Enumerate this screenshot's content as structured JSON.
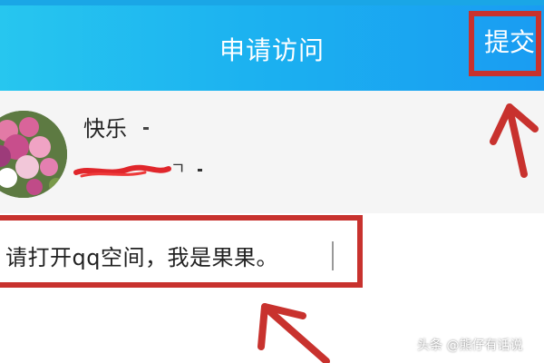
{
  "colors": {
    "header_start": "#27c6ef",
    "header_end": "#1a9cf2",
    "highlight": "#c8322e",
    "profile_bg": "#f5f5f5"
  },
  "header": {
    "title": "申请访问",
    "submit_label": "提交"
  },
  "profile": {
    "username": "快乐",
    "avatar_icon": "flower-avatar",
    "sub_text": "ㄱ"
  },
  "message": {
    "value": "请打开qq空间，我是果果。"
  },
  "watermark": {
    "text": "头条 @熊仔有话说"
  }
}
